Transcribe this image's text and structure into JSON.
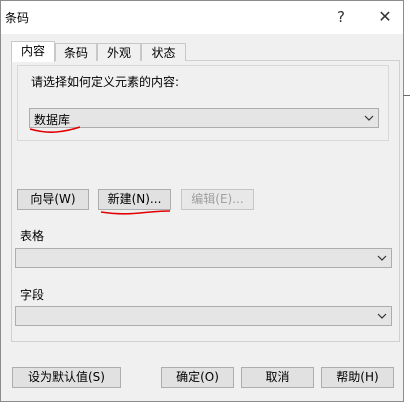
{
  "window": {
    "title": "条码",
    "help_glyph": "?",
    "close_glyph": "✕"
  },
  "tabs": [
    {
      "label": "内容",
      "active": true
    },
    {
      "label": "条码",
      "active": false
    },
    {
      "label": "外观",
      "active": false
    },
    {
      "label": "状态",
      "active": false
    }
  ],
  "content": {
    "prompt": "请选择如何定义元素的内容:",
    "source_value": "数据库",
    "buttons": {
      "wizard": "向导(W)",
      "new": "新建(N)...",
      "edit": "编辑(E)..."
    },
    "table_label": "表格",
    "table_value": "",
    "field_label": "字段",
    "field_value": ""
  },
  "footer": {
    "set_default": "设为默认值(S)",
    "ok": "确定(O)",
    "cancel": "取消",
    "help": "帮助(H)"
  },
  "colors": {
    "annotation": "#e00000",
    "disabled_text": "#a0a0a0"
  }
}
